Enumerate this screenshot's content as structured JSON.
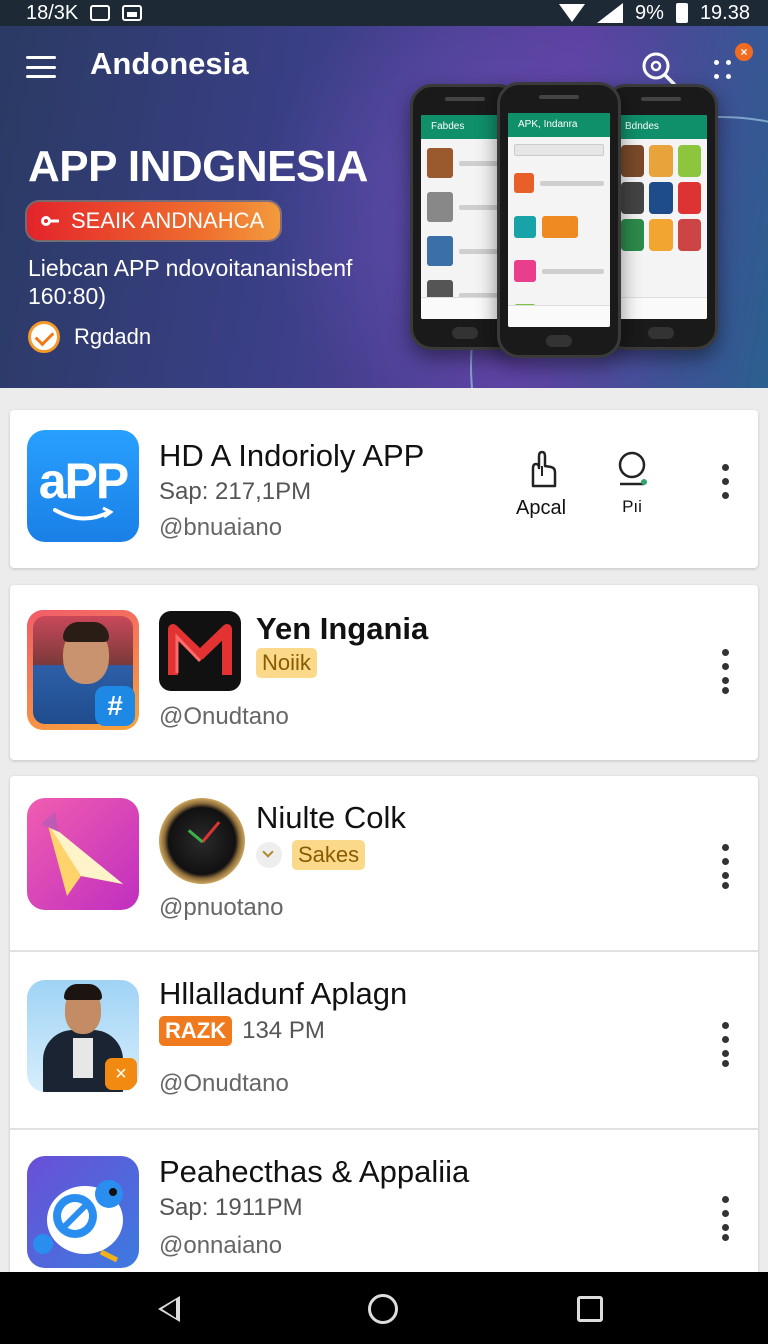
{
  "status_bar": {
    "left_text": "18/3K",
    "battery": "9%",
    "time": "19.38"
  },
  "app_bar": {
    "title": "Andonesia",
    "notification_count": "×"
  },
  "hero": {
    "title": "APP INDGNESIA",
    "pill": "SEAIK ANDNAHCA",
    "description": "Liebcan APP ndovoitananisbenf 160:80)",
    "check_label": "Rgdadn",
    "phones": [
      {
        "screen_title": "Fabdes"
      },
      {
        "screen_title": "APK, Indanra"
      },
      {
        "screen_title": "Bdndes"
      }
    ]
  },
  "apps": [
    {
      "name": "HD A Indorioly APP",
      "meta": "Sap: 217,1PM",
      "author": "@bnuaiano",
      "icon_text": "aPP",
      "actions": [
        {
          "label": "Apcal"
        },
        {
          "label": "Pıi"
        }
      ]
    },
    {
      "name": "Yen Ingania",
      "badge": "Noiik",
      "author": "@Onudtano"
    },
    {
      "name": "Niulte Colk",
      "badge": "Sakes",
      "author": "@pnuotano"
    },
    {
      "name": "Hllalladunf Aplagn",
      "badge": "RAZK",
      "meta": "134 PM",
      "author": "@Onudtano"
    },
    {
      "name": "Peahecthas & Appaliia",
      "meta": "Sap: 1911PM",
      "author": "@onnaiano"
    }
  ],
  "colors": {
    "accent_green": "#0f8f6a",
    "accent_orange": "#f26b21",
    "hero_purple": "#3a3f86"
  }
}
